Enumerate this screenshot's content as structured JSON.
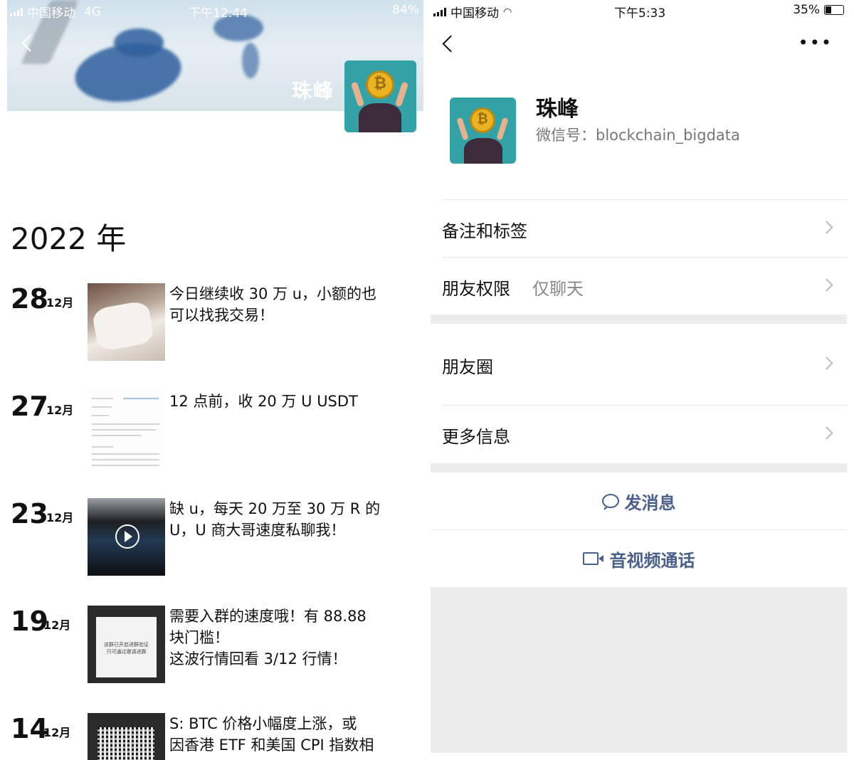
{
  "left": {
    "status": {
      "carrier": "中国移动",
      "network": "4G",
      "time": "下午12:44",
      "battery": "84%"
    },
    "cover_name": "珠峰",
    "year": "2022 年",
    "posts": [
      {
        "day": "28",
        "month": "12月",
        "text": "今日继续收 30 万 u，小额的也\n可以找我交易！"
      },
      {
        "day": "27",
        "month": "12月",
        "text": "12 点前，收 20 万 U  USDT"
      },
      {
        "day": "23",
        "month": "12月",
        "text": "缺 u，每天 20 万至 30 万 R 的\nU，U 商大哥速度私聊我！"
      },
      {
        "day": "19",
        "month": "12月",
        "text": "需要入群的速度哦！有 88.88\n块门槛！\n这波行情回看 3/12 行情！"
      },
      {
        "day": "14",
        "month": "12月",
        "text": "S:    BTC 价格小幅度上涨，或\n因香港 ETF 和美国 CPI 指数相"
      }
    ],
    "post4_thumb_caption": "该群已开启进群验证\n只可通过邀请进群"
  },
  "right": {
    "status": {
      "carrier": "中国移动",
      "time": "下午5:33",
      "battery": "35%"
    },
    "profile": {
      "name": "珠峰",
      "wechat_id": "微信号：blockchain_bigdata"
    },
    "menu": {
      "remarks_tags": "备注和标签",
      "permissions_label": "朋友权限",
      "permissions_value": "仅聊天",
      "moments": "朋友圈",
      "more_info": "更多信息"
    },
    "actions": {
      "send_message": "发消息",
      "av_call": "音视频通话"
    }
  }
}
